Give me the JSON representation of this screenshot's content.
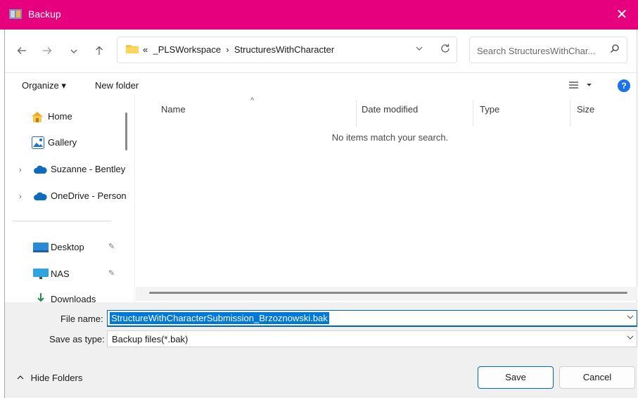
{
  "window": {
    "title": "Backup",
    "close_glyph": "✕",
    "title_bar_color": "#e6007e"
  },
  "nav": {
    "back_icon": "arrow-left-icon",
    "forward_icon": "arrow-right-icon",
    "recent_icon": "chevron-down-icon",
    "up_icon": "arrow-up-icon"
  },
  "address": {
    "overflow": "«",
    "crumbs": [
      "_PLSWorkspace",
      "StructuresWithCharacter"
    ],
    "separator": "›"
  },
  "search": {
    "placeholder": "Search StructuresWithChar..."
  },
  "toolbar": {
    "organize": "Organize ▾",
    "new_folder": "New folder",
    "view_icon": "view-list-icon",
    "help": "?"
  },
  "sidebar": {
    "items": [
      {
        "label": "Home",
        "icon": "home-icon"
      },
      {
        "label": "Gallery",
        "icon": "gallery-icon"
      },
      {
        "label": "Suzanne - Bentley",
        "icon": "cloud-icon"
      },
      {
        "label": "OneDrive - Personal",
        "icon": "cloud-icon"
      },
      {
        "label": "Desktop",
        "icon": "desktop-icon"
      },
      {
        "label": "NAS",
        "icon": "monitor-icon"
      },
      {
        "label": "Downloads",
        "icon": "download-icon"
      }
    ]
  },
  "columns": [
    "Name",
    "Date modified",
    "Type",
    "Size"
  ],
  "empty_message": "No items match your search.",
  "form": {
    "file_name_label": "File name:",
    "file_name_value": "StructureWithCharacterSubmission_Brzoznowski.bak",
    "save_type_label": "Save as type:",
    "save_type_value": "Backup files(*.bak)"
  },
  "buttons": {
    "save": "Save",
    "cancel": "Cancel",
    "hide_folders": "Hide Folders"
  },
  "colors": {
    "accent": "#0067c0",
    "selection": "#0078d7",
    "help": "#1a73e8"
  }
}
